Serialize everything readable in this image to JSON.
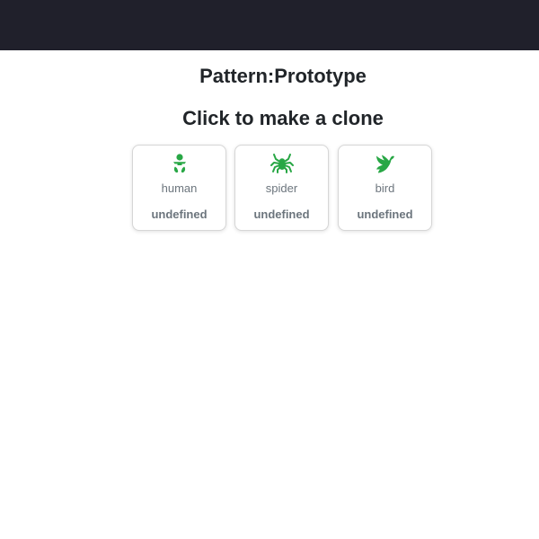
{
  "header": {
    "title": "Pattern:Prototype",
    "subtitle": "Click to make a clone"
  },
  "colors": {
    "topbar": "#20202b",
    "icon": "#28a745",
    "muted_text": "#6c757d"
  },
  "cards": [
    {
      "icon": "baby-icon",
      "name": "human",
      "value": "undefined"
    },
    {
      "icon": "spider-icon",
      "name": "spider",
      "value": "undefined"
    },
    {
      "icon": "dove-icon",
      "name": "bird",
      "value": "undefined"
    }
  ]
}
